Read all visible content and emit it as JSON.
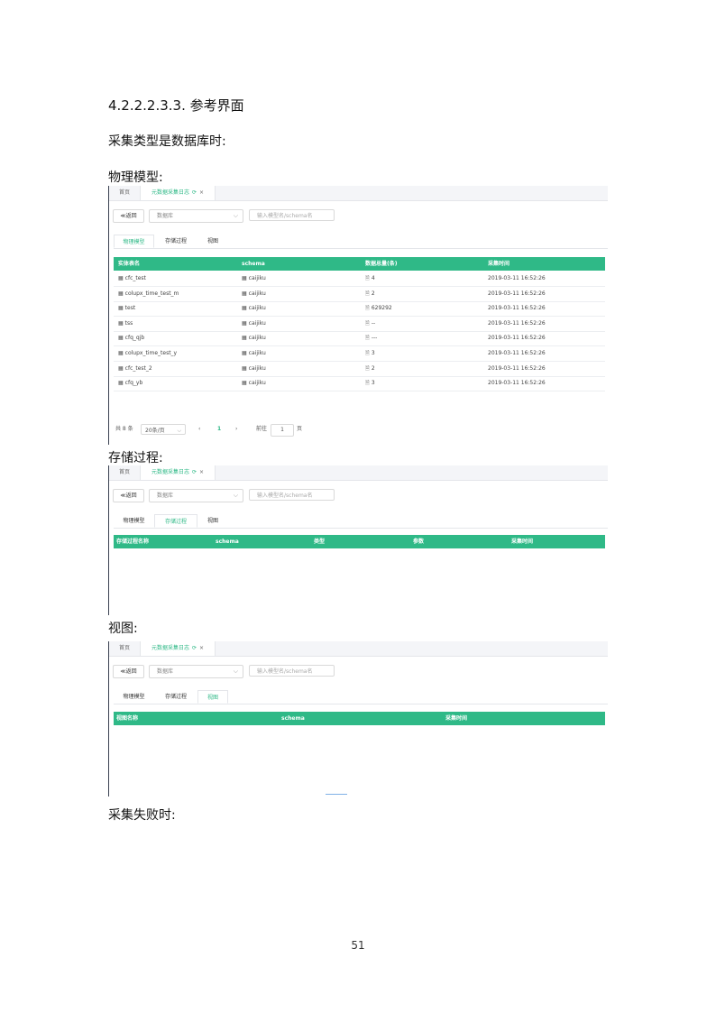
{
  "doc": {
    "heading": "4.2.2.2.3.3. 参考界面",
    "intro": "采集类型是数据库时:",
    "section_physical": "物理模型:",
    "section_procedure": "存储过程:",
    "section_view": "视图:",
    "section_fail": "采集失败时:",
    "page_number": "51"
  },
  "ui": {
    "tab_home": "首页",
    "tab_active": "元数据采集日志",
    "tab_refresh_icon": "⟳",
    "tab_close_icon": "×",
    "back_button": "≪返回",
    "select_value": "数据库",
    "select_chevron": "⌵",
    "search_placeholder": "输入模型名/schema名",
    "subtab_physical": "物理模型",
    "subtab_procedure": "存储过程",
    "subtab_view": "视图"
  },
  "physical": {
    "columns": [
      "实体表名",
      "schema",
      "数据总量(条)",
      "采集时间"
    ],
    "rows": [
      {
        "name": "cfc_test",
        "schema": "caijiku",
        "count": "4",
        "time": "2019-03-11 16:52:26"
      },
      {
        "name": "colupx_time_test_m",
        "schema": "caijiku",
        "count": "2",
        "time": "2019-03-11 16:52:26"
      },
      {
        "name": "test",
        "schema": "caijiku",
        "count": "629292",
        "time": "2019-03-11 16:52:26"
      },
      {
        "name": "tss",
        "schema": "caijiku",
        "count": "--",
        "time": "2019-03-11 16:52:26"
      },
      {
        "name": "cfq_qjb",
        "schema": "caijiku",
        "count": "---",
        "time": "2019-03-11 16:52:26"
      },
      {
        "name": "colupx_time_test_y",
        "schema": "caijiku",
        "count": "3",
        "time": "2019-03-11 16:52:26"
      },
      {
        "name": "cfc_test_2",
        "schema": "caijiku",
        "count": "2",
        "time": "2019-03-11 16:52:26"
      },
      {
        "name": "cfq_yb",
        "schema": "caijiku",
        "count": "3",
        "time": "2019-03-11 16:52:26"
      }
    ],
    "pager": {
      "total": "共 8 条",
      "page_size": "20条/页",
      "prev": "‹",
      "current": "1",
      "next": "›",
      "goto_label": "前往",
      "goto_value": "1",
      "page_suffix": "页"
    }
  },
  "procedure": {
    "columns": [
      "存储过程名称",
      "schema",
      "类型",
      "参数",
      "采集时间"
    ]
  },
  "view": {
    "columns": [
      "视图名称",
      "schema",
      "采集时间"
    ]
  },
  "icons": {
    "table_icon": "▦",
    "count_icon": "🗎"
  }
}
